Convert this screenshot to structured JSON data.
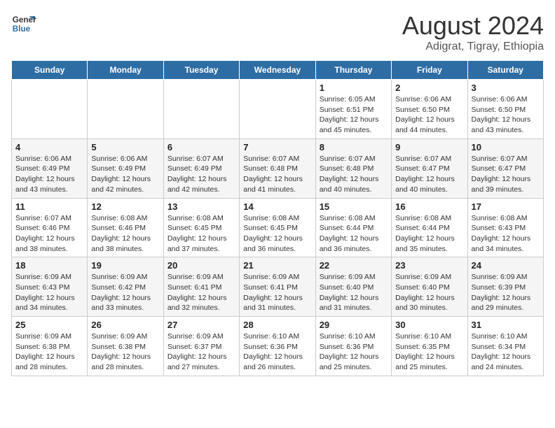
{
  "header": {
    "logo_line1": "General",
    "logo_line2": "Blue",
    "month_year": "August 2024",
    "location": "Adigrat, Tigray, Ethiopia"
  },
  "weekdays": [
    "Sunday",
    "Monday",
    "Tuesday",
    "Wednesday",
    "Thursday",
    "Friday",
    "Saturday"
  ],
  "weeks": [
    [
      {
        "day": "",
        "info": ""
      },
      {
        "day": "",
        "info": ""
      },
      {
        "day": "",
        "info": ""
      },
      {
        "day": "",
        "info": ""
      },
      {
        "day": "1",
        "info": "Sunrise: 6:05 AM\nSunset: 6:51 PM\nDaylight: 12 hours\nand 45 minutes."
      },
      {
        "day": "2",
        "info": "Sunrise: 6:06 AM\nSunset: 6:50 PM\nDaylight: 12 hours\nand 44 minutes."
      },
      {
        "day": "3",
        "info": "Sunrise: 6:06 AM\nSunset: 6:50 PM\nDaylight: 12 hours\nand 43 minutes."
      }
    ],
    [
      {
        "day": "4",
        "info": "Sunrise: 6:06 AM\nSunset: 6:49 PM\nDaylight: 12 hours\nand 43 minutes."
      },
      {
        "day": "5",
        "info": "Sunrise: 6:06 AM\nSunset: 6:49 PM\nDaylight: 12 hours\nand 42 minutes."
      },
      {
        "day": "6",
        "info": "Sunrise: 6:07 AM\nSunset: 6:49 PM\nDaylight: 12 hours\nand 42 minutes."
      },
      {
        "day": "7",
        "info": "Sunrise: 6:07 AM\nSunset: 6:48 PM\nDaylight: 12 hours\nand 41 minutes."
      },
      {
        "day": "8",
        "info": "Sunrise: 6:07 AM\nSunset: 6:48 PM\nDaylight: 12 hours\nand 40 minutes."
      },
      {
        "day": "9",
        "info": "Sunrise: 6:07 AM\nSunset: 6:47 PM\nDaylight: 12 hours\nand 40 minutes."
      },
      {
        "day": "10",
        "info": "Sunrise: 6:07 AM\nSunset: 6:47 PM\nDaylight: 12 hours\nand 39 minutes."
      }
    ],
    [
      {
        "day": "11",
        "info": "Sunrise: 6:07 AM\nSunset: 6:46 PM\nDaylight: 12 hours\nand 38 minutes."
      },
      {
        "day": "12",
        "info": "Sunrise: 6:08 AM\nSunset: 6:46 PM\nDaylight: 12 hours\nand 38 minutes."
      },
      {
        "day": "13",
        "info": "Sunrise: 6:08 AM\nSunset: 6:45 PM\nDaylight: 12 hours\nand 37 minutes."
      },
      {
        "day": "14",
        "info": "Sunrise: 6:08 AM\nSunset: 6:45 PM\nDaylight: 12 hours\nand 36 minutes."
      },
      {
        "day": "15",
        "info": "Sunrise: 6:08 AM\nSunset: 6:44 PM\nDaylight: 12 hours\nand 36 minutes."
      },
      {
        "day": "16",
        "info": "Sunrise: 6:08 AM\nSunset: 6:44 PM\nDaylight: 12 hours\nand 35 minutes."
      },
      {
        "day": "17",
        "info": "Sunrise: 6:08 AM\nSunset: 6:43 PM\nDaylight: 12 hours\nand 34 minutes."
      }
    ],
    [
      {
        "day": "18",
        "info": "Sunrise: 6:09 AM\nSunset: 6:43 PM\nDaylight: 12 hours\nand 34 minutes."
      },
      {
        "day": "19",
        "info": "Sunrise: 6:09 AM\nSunset: 6:42 PM\nDaylight: 12 hours\nand 33 minutes."
      },
      {
        "day": "20",
        "info": "Sunrise: 6:09 AM\nSunset: 6:41 PM\nDaylight: 12 hours\nand 32 minutes."
      },
      {
        "day": "21",
        "info": "Sunrise: 6:09 AM\nSunset: 6:41 PM\nDaylight: 12 hours\nand 31 minutes."
      },
      {
        "day": "22",
        "info": "Sunrise: 6:09 AM\nSunset: 6:40 PM\nDaylight: 12 hours\nand 31 minutes."
      },
      {
        "day": "23",
        "info": "Sunrise: 6:09 AM\nSunset: 6:40 PM\nDaylight: 12 hours\nand 30 minutes."
      },
      {
        "day": "24",
        "info": "Sunrise: 6:09 AM\nSunset: 6:39 PM\nDaylight: 12 hours\nand 29 minutes."
      }
    ],
    [
      {
        "day": "25",
        "info": "Sunrise: 6:09 AM\nSunset: 6:38 PM\nDaylight: 12 hours\nand 28 minutes."
      },
      {
        "day": "26",
        "info": "Sunrise: 6:09 AM\nSunset: 6:38 PM\nDaylight: 12 hours\nand 28 minutes."
      },
      {
        "day": "27",
        "info": "Sunrise: 6:09 AM\nSunset: 6:37 PM\nDaylight: 12 hours\nand 27 minutes."
      },
      {
        "day": "28",
        "info": "Sunrise: 6:10 AM\nSunset: 6:36 PM\nDaylight: 12 hours\nand 26 minutes."
      },
      {
        "day": "29",
        "info": "Sunrise: 6:10 AM\nSunset: 6:36 PM\nDaylight: 12 hours\nand 25 minutes."
      },
      {
        "day": "30",
        "info": "Sunrise: 6:10 AM\nSunset: 6:35 PM\nDaylight: 12 hours\nand 25 minutes."
      },
      {
        "day": "31",
        "info": "Sunrise: 6:10 AM\nSunset: 6:34 PM\nDaylight: 12 hours\nand 24 minutes."
      }
    ]
  ]
}
